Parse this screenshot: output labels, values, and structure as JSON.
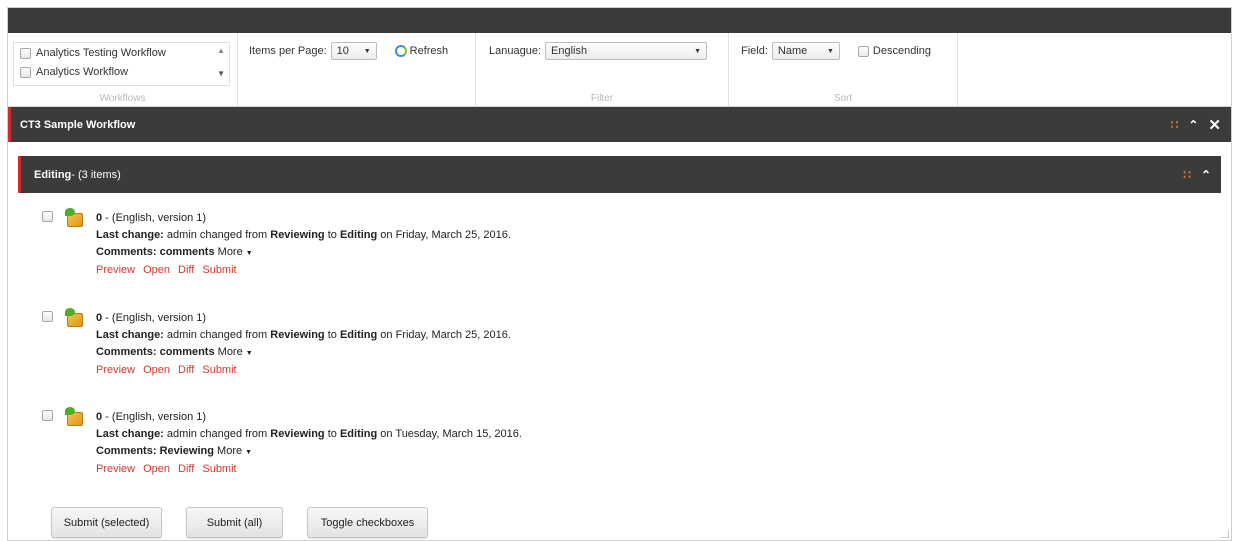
{
  "ribbon": {
    "workflows": {
      "items": [
        {
          "label": "Analytics Testing Workflow"
        },
        {
          "label": "Analytics Workflow"
        }
      ],
      "caption": "Workflows"
    },
    "paging": {
      "label": "Items per Page:",
      "value": "10",
      "refresh_label": "Refresh"
    },
    "filter": {
      "label": "Lanuague:",
      "value": "English",
      "caption": "Filter"
    },
    "sort": {
      "field_label": "Field:",
      "field_value": "Name",
      "descending_label": "Descending",
      "caption": "Sort"
    }
  },
  "workflow_panel": {
    "title": "CT3 Sample Workflow"
  },
  "state_panel": {
    "title": "Editing",
    "count": " - (3 items)"
  },
  "items": [
    {
      "name": "0",
      "meta": " - (English, version 1)",
      "last_change_label": "Last change:",
      "last_change_pre": " admin changed from ",
      "from_state": "Reviewing",
      "to_word": " to ",
      "to_state": "Editing",
      "on_date": " on Friday, March 25, 2016.",
      "comments_label": "Comments:",
      "comments_value": " comments",
      "more_label": "More",
      "actions": [
        "Preview",
        "Open",
        "Diff",
        "Submit"
      ]
    },
    {
      "name": "0",
      "meta": " - (English, version 1)",
      "last_change_label": "Last change:",
      "last_change_pre": " admin changed from ",
      "from_state": "Reviewing",
      "to_word": " to ",
      "to_state": "Editing",
      "on_date": " on Friday, March 25, 2016.",
      "comments_label": "Comments:",
      "comments_value": " comments",
      "more_label": "More",
      "actions": [
        "Preview",
        "Open",
        "Diff",
        "Submit"
      ]
    },
    {
      "name": "0",
      "meta": " - (English, version 1)",
      "last_change_label": "Last change:",
      "last_change_pre": " admin changed from ",
      "from_state": "Reviewing",
      "to_word": " to ",
      "to_state": "Editing",
      "on_date": " on Tuesday, March 15, 2016.",
      "comments_label": "Comments:",
      "comments_value": " Reviewing",
      "more_label": "More",
      "actions": [
        "Preview",
        "Open",
        "Diff",
        "Submit"
      ]
    }
  ],
  "buttons": {
    "submit_selected": "Submit (selected)",
    "submit_all": "Submit (all)",
    "toggle_checkboxes": "Toggle checkboxes"
  },
  "colors": {
    "header_bg": "#3b3b3b",
    "accent_red": "#d12a2a",
    "link_red": "#d03a2e",
    "rss_orange": "#f07c1e"
  }
}
